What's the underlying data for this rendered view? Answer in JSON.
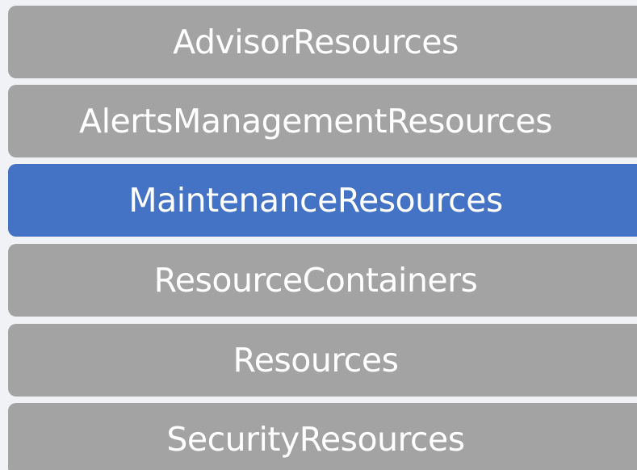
{
  "list": {
    "items": [
      {
        "label": "AdvisorResources",
        "selected": false
      },
      {
        "label": "AlertsManagementResources",
        "selected": false
      },
      {
        "label": "MaintenanceResources",
        "selected": true
      },
      {
        "label": "ResourceContainers",
        "selected": false
      },
      {
        "label": "Resources",
        "selected": false
      },
      {
        "label": "SecurityResources",
        "selected": false
      }
    ]
  },
  "colors": {
    "background": "#f0f2f5",
    "item": "#a3a3a3",
    "item_selected": "#4472c4",
    "text": "#ffffff"
  }
}
